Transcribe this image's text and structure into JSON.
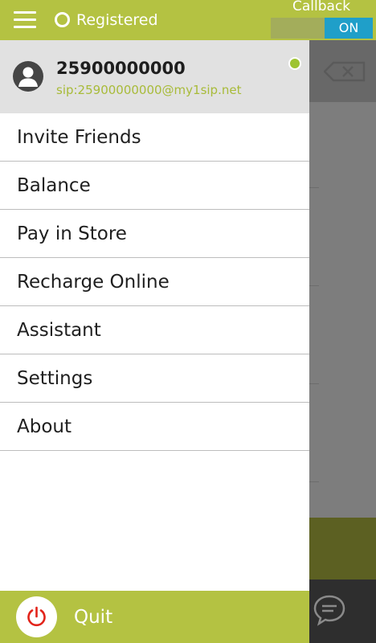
{
  "topbar": {
    "status": "Registered",
    "callback_label": "Callback",
    "toggle_state": "ON"
  },
  "profile": {
    "number": "25900000000",
    "sip": "sip:25900000000@my1sip.net"
  },
  "menu": {
    "items": [
      {
        "label": "Invite Friends"
      },
      {
        "label": "Balance"
      },
      {
        "label": "Pay in Store"
      },
      {
        "label": "Recharge Online"
      },
      {
        "label": "Assistant"
      },
      {
        "label": "Settings"
      },
      {
        "label": "About"
      }
    ]
  },
  "quit": {
    "label": "Quit"
  },
  "icons": [
    "hamburger-icon",
    "status-icon",
    "avatar-icon",
    "online-status-icon",
    "power-icon",
    "backspace-icon",
    "chat-icon"
  ],
  "colors": {
    "brand": "#b4c242",
    "toggle_on": "#1f9fc9",
    "sip_text": "#a8bb39",
    "quit_icon": "#e2231a",
    "online": "#9ec431"
  }
}
